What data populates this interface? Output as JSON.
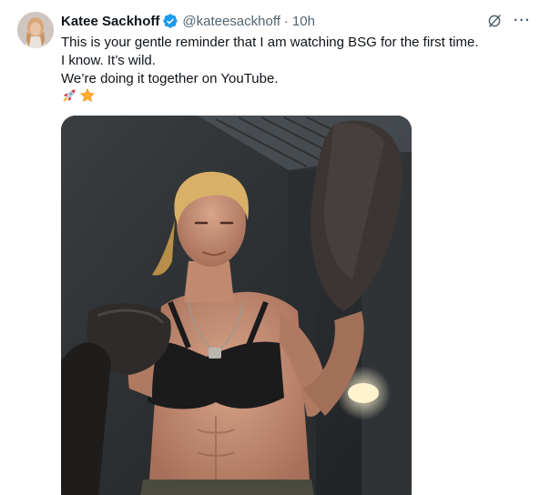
{
  "author": {
    "name": "Katee Sackhoff",
    "handle": "@kateesackhoff",
    "separator": "·",
    "time": "10h"
  },
  "icons": {
    "verified": "verified-badge-icon",
    "grok": "grok-icon",
    "more": "more-icon"
  },
  "colors": {
    "verified": "#1d9bf0",
    "secondary_text": "#536471",
    "primary_text": "#0f1419"
  },
  "tweet": {
    "lines": [
      "This is your gentle reminder that I am watching BSG for the first time.",
      "I know. It’s wild.",
      "We’re doing it together on YouTube."
    ],
    "emojis": [
      "rocket-emoji",
      "star-emoji"
    ]
  }
}
